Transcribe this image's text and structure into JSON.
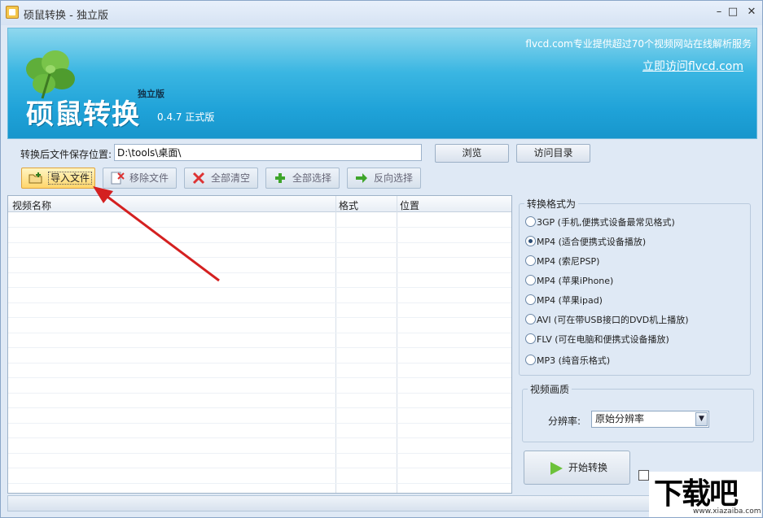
{
  "window": {
    "title": "硕鼠转换 - 独立版",
    "minimize": "–",
    "maximize": "□",
    "close": "✕"
  },
  "banner": {
    "brand": "硕鼠转换",
    "edition": "独立版",
    "version": "0.4.7  正式版",
    "slogan": "flvcd.com专业提供超过70个视频网站在线解析服务",
    "visit_link": "立即访问flvcd.com",
    "logo_icon": "leaf-icon"
  },
  "path": {
    "label": "转换后文件保存位置:",
    "value": "D:\\tools\\桌面\\",
    "browse": "浏览",
    "open_dir": "访问目录"
  },
  "toolbar": {
    "import": "导入文件",
    "remove": "移除文件",
    "clear": "全部清空",
    "select_all": "全部选择",
    "invert": "反向选择"
  },
  "table": {
    "columns": [
      "视频名称",
      "格式",
      "位置"
    ],
    "rows": []
  },
  "format_group": {
    "title": "转换格式为",
    "options": [
      {
        "label": "3GP (手机,便携式设备最常见格式)",
        "checked": false
      },
      {
        "label": "MP4 (适合便携式设备播放)",
        "checked": true
      },
      {
        "label": "MP4 (索尼PSP)",
        "checked": false
      },
      {
        "label": "MP4 (苹果iPhone)",
        "checked": false
      },
      {
        "label": "MP4 (苹果ipad)",
        "checked": false
      },
      {
        "label": "AVI  (可在带USB接口的DVD机上播放)",
        "checked": false
      },
      {
        "label": "FLV  (可在电脑和便携式设备播放)",
        "checked": false
      },
      {
        "label": "MP3 (纯音乐格式)",
        "checked": false
      }
    ]
  },
  "quality_group": {
    "title": "视频画质",
    "resolution_label": "分辨率:",
    "resolution_value": "原始分辨率"
  },
  "start_button": "开始转换",
  "watermark": {
    "big": "下载吧",
    "small": "www.xiazaiba.com"
  },
  "colors": {
    "banner_blue": "#1fa2d8",
    "accent_arrow": "#d42020",
    "active_button": "#ffd66b"
  }
}
